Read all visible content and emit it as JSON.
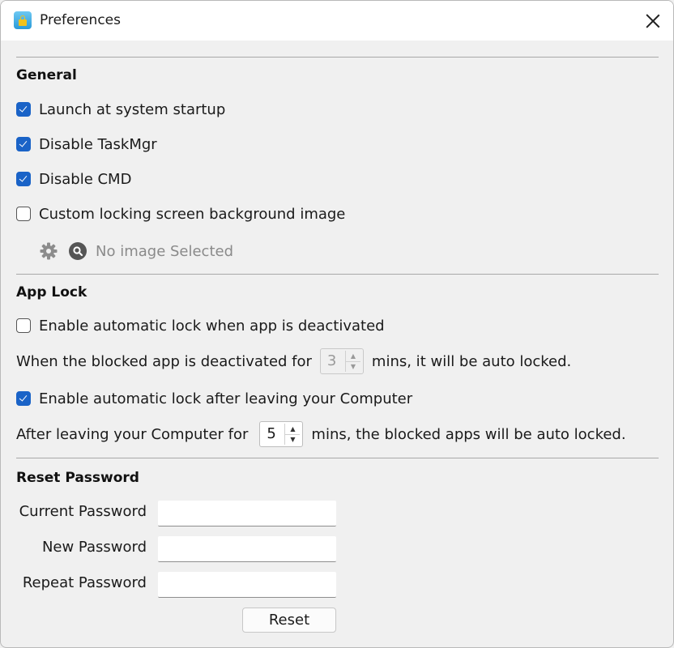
{
  "window": {
    "title": "Preferences",
    "app_icon": "lock-app-icon",
    "close_icon": "close-icon"
  },
  "general": {
    "heading": "General",
    "options": [
      {
        "label": "Launch at system startup",
        "checked": true
      },
      {
        "label": "Disable TaskMgr",
        "checked": true
      },
      {
        "label": "Disable CMD",
        "checked": true
      },
      {
        "label": "Custom locking screen background image",
        "checked": false
      }
    ],
    "image": {
      "settings_icon": "gear-icon",
      "browse_icon": "search-icon",
      "status": "No image Selected"
    }
  },
  "app_lock": {
    "heading": "App Lock",
    "deactivated_option": {
      "label": "Enable automatic lock when app is deactivated",
      "checked": false
    },
    "deactivated_row": {
      "prefix": "When the blocked app is deactivated for",
      "value": "3",
      "suffix": "mins, it will be auto locked.",
      "enabled": false
    },
    "leaving_option": {
      "label": "Enable automatic lock after leaving your Computer",
      "checked": true
    },
    "leaving_row": {
      "prefix": "After leaving your Computer for",
      "value": "5",
      "suffix": "mins, the blocked apps will be auto locked.",
      "enabled": true
    }
  },
  "reset_password": {
    "heading": "Reset Password",
    "fields": [
      {
        "label": "Current Password",
        "value": ""
      },
      {
        "label": "New Password",
        "value": ""
      },
      {
        "label": "Repeat Password",
        "value": ""
      }
    ],
    "button": "Reset"
  },
  "spinner_arrows": {
    "up": "▲",
    "down": "▼"
  }
}
